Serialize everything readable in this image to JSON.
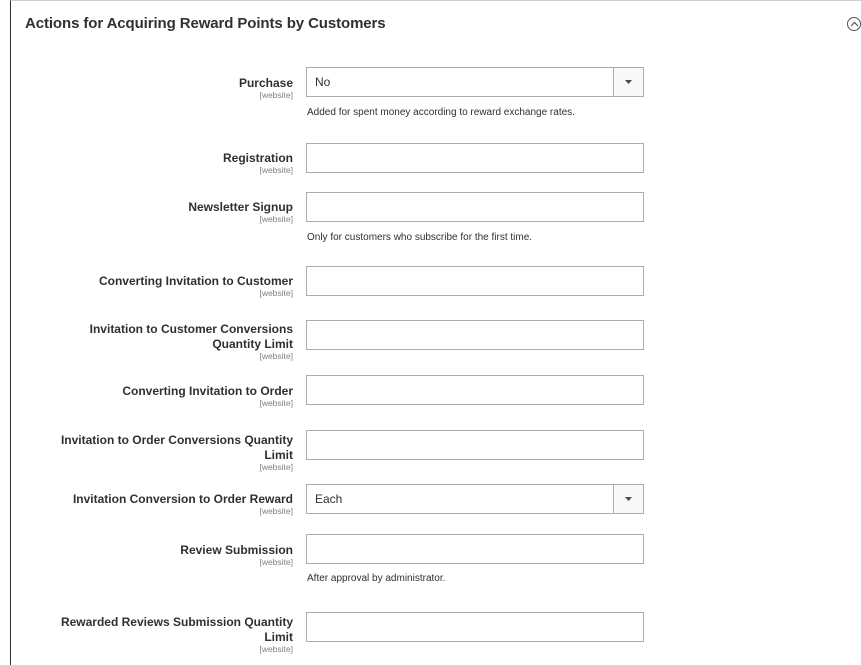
{
  "section": {
    "title": "Actions for Acquiring Reward Points by Customers",
    "collapse_icon": "collapse-circle-chevron-up-icon"
  },
  "scope_label": "[website]",
  "fields": {
    "purchase": {
      "label": "Purchase",
      "value": "No",
      "note": "Added for spent money according to reward exchange rates."
    },
    "registration": {
      "label": "Registration",
      "value": ""
    },
    "newsletter": {
      "label": "Newsletter Signup",
      "value": "",
      "note": "Only for customers who subscribe for the first time."
    },
    "conv_inv_customer": {
      "label": "Converting Invitation to Customer",
      "value": ""
    },
    "inv_customer_limit": {
      "label_line1": "Invitation to Customer Conversions",
      "label_line2": "Quantity Limit",
      "value": ""
    },
    "conv_inv_order": {
      "label": "Converting Invitation to Order",
      "value": ""
    },
    "inv_order_limit": {
      "label_line1": "Invitation to Order Conversions Quantity",
      "label_line2": "Limit",
      "value": ""
    },
    "inv_conv_reward": {
      "label": "Invitation Conversion to Order Reward",
      "value": "Each"
    },
    "review_submission": {
      "label": "Review Submission",
      "value": "",
      "note": "After approval by administrator."
    },
    "rewarded_reviews_limit": {
      "label_line1": "Rewarded Reviews Submission Quantity",
      "label_line2": "Limit",
      "value": ""
    }
  }
}
